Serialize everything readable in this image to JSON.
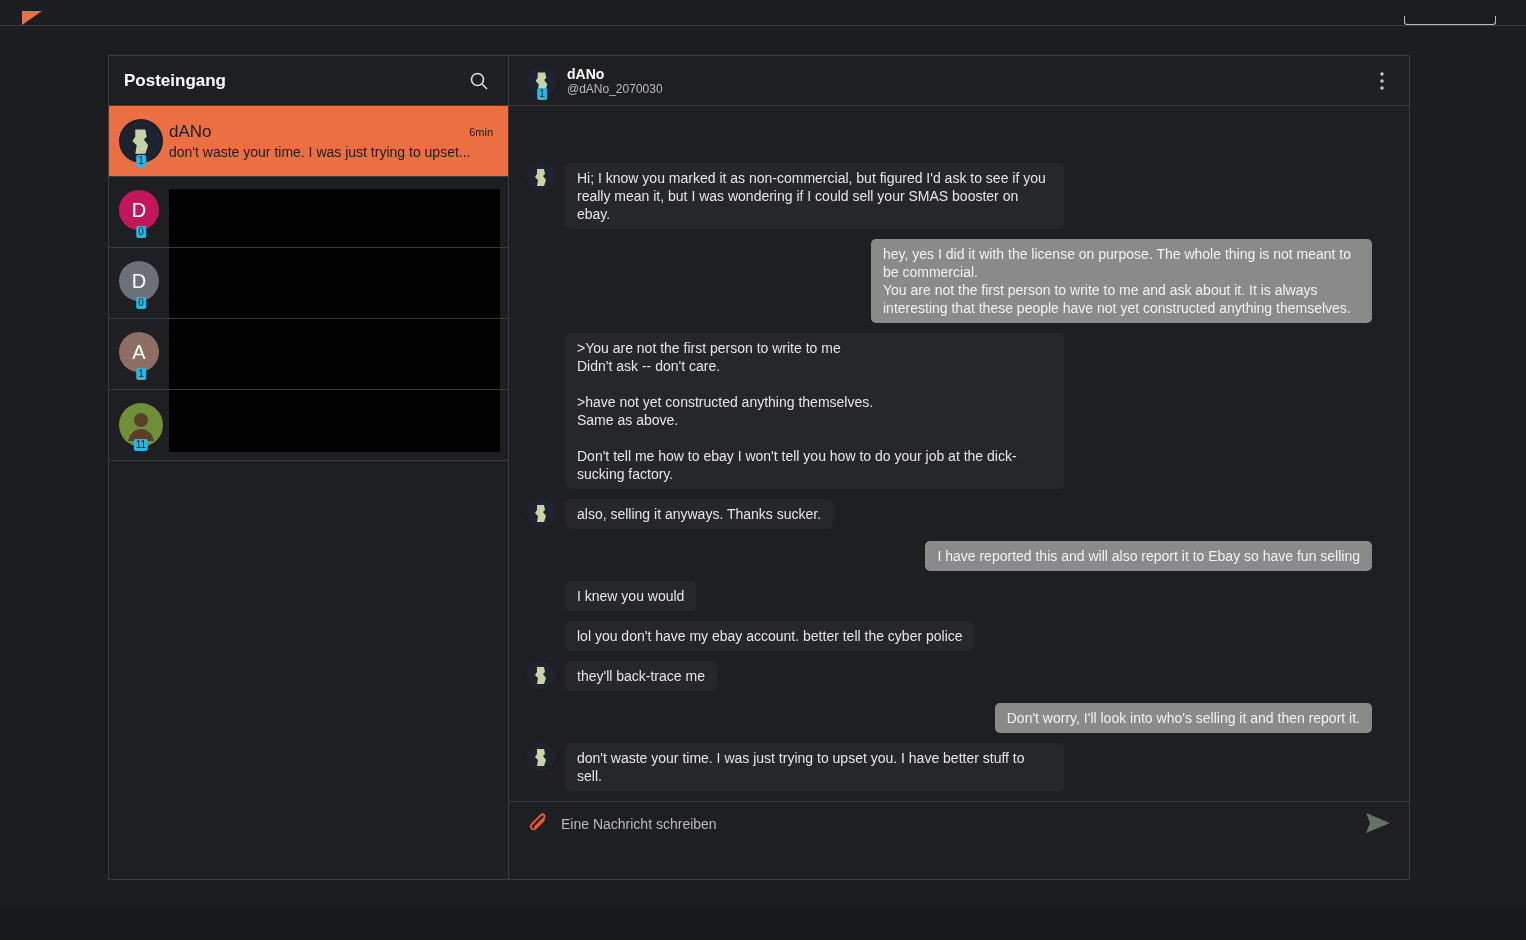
{
  "inbox": {
    "title": "Posteingang",
    "conversations": [
      {
        "kind": "photo",
        "name": "dANo",
        "time": "6min",
        "preview": "don't waste your time. I was just trying to upset...",
        "badge": "1",
        "selected": true,
        "color": "#16202c"
      },
      {
        "kind": "letter",
        "letter": "D",
        "badge": "0",
        "selected": false,
        "color": "#c2185b"
      },
      {
        "kind": "letter",
        "letter": "D",
        "badge": "0",
        "selected": false,
        "color": "#6b7177"
      },
      {
        "kind": "letter",
        "letter": "A",
        "badge": "1",
        "selected": false,
        "color": "#8d6e63"
      },
      {
        "kind": "photo",
        "badge": "11",
        "selected": false,
        "color": "#6f8f3a"
      }
    ]
  },
  "chat": {
    "name": "dANo",
    "handle": "@dANo_2070030",
    "badge": "1",
    "messages": [
      {
        "kind": "incoming",
        "avatar": true,
        "text": "Hi; I know you marked it as non-commercial, but figured I'd ask to see if you really mean it, but I was wondering if I could sell your SMAS booster on ebay."
      },
      {
        "kind": "outgoing",
        "avatar": false,
        "text": "hey, yes I did it with the license on purpose. The whole thing is not meant to be commercial.\nYou are not the first person to write to me and ask about it. It is always interesting that these people have not yet constructed anything themselves."
      },
      {
        "kind": "incoming",
        "avatar": false,
        "text": ">You are not the first person to write to me\nDidn't ask -- don't care.\n\n>have not yet constructed anything themselves.\nSame as above.\n\nDon't tell me how to ebay I won't tell you how to do your job at the dick-sucking factory."
      },
      {
        "kind": "incoming",
        "avatar": true,
        "text": "also, selling it anyways. Thanks sucker."
      },
      {
        "kind": "outgoing",
        "avatar": false,
        "text": "I have reported this and will also report it to Ebay so have fun selling"
      },
      {
        "kind": "incoming",
        "avatar": false,
        "text": "I knew you would"
      },
      {
        "kind": "incoming",
        "avatar": false,
        "text": "lol you don't have my ebay account. better tell the cyber police"
      },
      {
        "kind": "incoming",
        "avatar": true,
        "text": "they'll back-trace me"
      },
      {
        "kind": "outgoing",
        "avatar": false,
        "text": "Don't worry, I'll look into who's selling it and then report it."
      },
      {
        "kind": "incoming",
        "avatar": true,
        "text": "don't waste your time. I was just trying to upset you. I have better stuff to sell."
      }
    ]
  },
  "composer": {
    "placeholder": "Eine Nachricht schreiben"
  }
}
